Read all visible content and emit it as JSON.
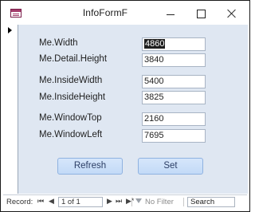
{
  "window": {
    "title": "InfoFormF",
    "icons": {
      "app": "access-form-icon",
      "minimize": "minimize-icon",
      "maximize": "maximize-icon",
      "close": "close-icon"
    }
  },
  "form": {
    "fields": [
      {
        "label": "Me.Width",
        "value": "4860",
        "selected": true
      },
      {
        "label": "Me.Detail.Height",
        "value": "3840"
      },
      {
        "label": "Me.InsideWidth",
        "value": "5400"
      },
      {
        "label": "Me.InsideHeight",
        "value": "3825"
      },
      {
        "label": "Me.WindowTop",
        "value": "2160"
      },
      {
        "label": "Me.WindowLeft",
        "value": "7695"
      }
    ],
    "buttons": {
      "refresh": "Refresh",
      "set": "Set"
    }
  },
  "navigation": {
    "record_label": "Record:",
    "first": "⏮",
    "prev": "◀",
    "position": "1 of 1",
    "next": "▶",
    "last": "⏭",
    "new": "▶*",
    "filter_label": "No Filter",
    "search_placeholder": "Search"
  },
  "colors": {
    "form_background": "#dfe7f2",
    "button": "#c9ddf7"
  }
}
